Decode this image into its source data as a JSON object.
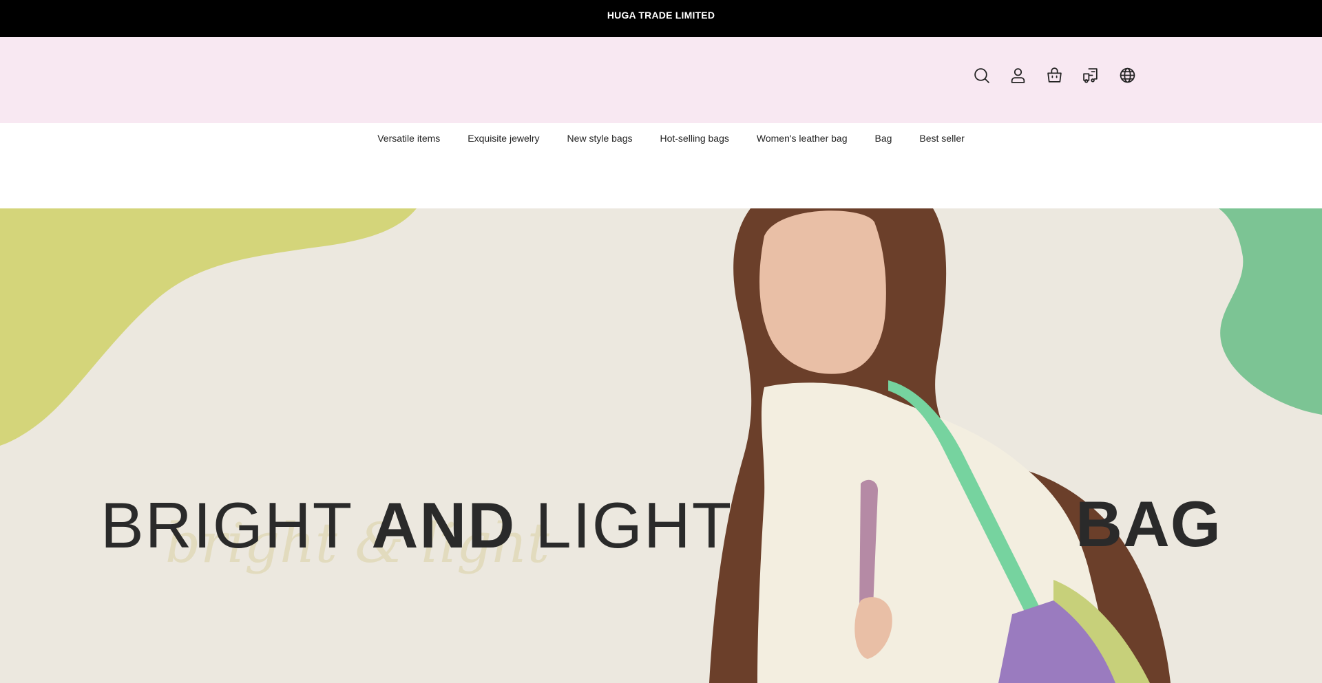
{
  "announcement": {
    "text": "HUGA TRADE LIMITED"
  },
  "header": {
    "icons": [
      "search-icon",
      "account-icon",
      "cart-icon",
      "order-tracking-icon",
      "language-icon"
    ]
  },
  "nav": {
    "items": [
      {
        "label": "Versatile items"
      },
      {
        "label": "Exquisite jewelry"
      },
      {
        "label": "New style bags"
      },
      {
        "label": "Hot-selling bags"
      },
      {
        "label": "Women's leather bag"
      },
      {
        "label": "Bag"
      },
      {
        "label": "Best seller"
      }
    ]
  },
  "hero": {
    "title_part1": "BRIGHT",
    "title_part2": "AND",
    "title_part3": "LIGHT",
    "title_right": "BAG",
    "script_text": "bright & light"
  },
  "colors": {
    "announcement_bg": "#000000",
    "header_bg": "#f8e8f2",
    "hero_bg": "#ece8df",
    "blob_yellow": "#d4d57a",
    "blob_green": "#7cc494"
  }
}
